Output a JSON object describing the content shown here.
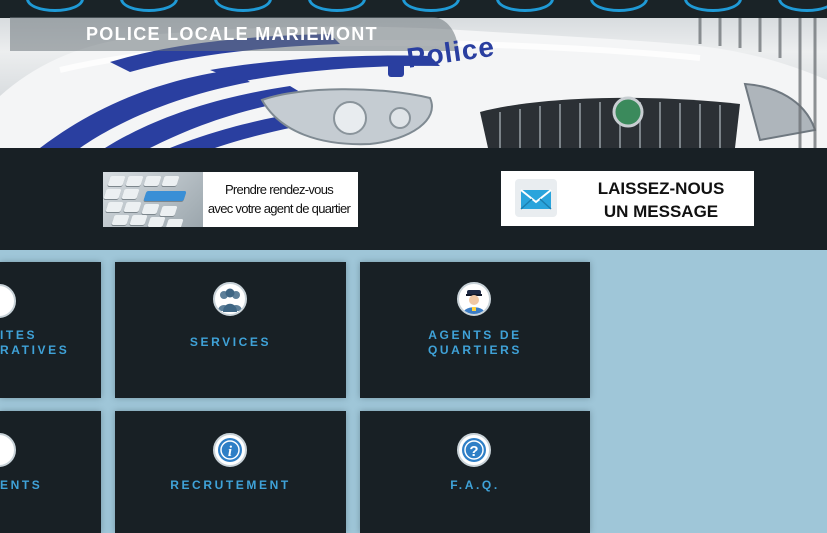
{
  "header": {
    "title": "POLICE LOCALE MARIEMONT",
    "car_lettering": "Police"
  },
  "banners": {
    "appointment": {
      "line1": "Prendre rendez-vous",
      "line2": "avec votre agent de quartier",
      "icon": "keyboard-icon"
    },
    "message": {
      "line1": "LAISSEZ-NOUS",
      "line2": "UN MESSAGE",
      "icon": "envelope-icon"
    }
  },
  "tiles": [
    {
      "line1": "ITES",
      "line2": "RATIVES",
      "icon": "partial-icon"
    },
    {
      "line1": "SERVICES",
      "icon": "group-icon"
    },
    {
      "line1": "AGENTS DE",
      "line2": "QUARTIERS",
      "icon": "police-officer-icon"
    },
    {
      "line1": "ENTS",
      "icon": "partial-icon"
    },
    {
      "line1": "RECRUTEMENT",
      "icon": "info-icon"
    },
    {
      "line1": "F.A.Q.",
      "icon": "question-icon"
    }
  ],
  "colors": {
    "page_background": "#9fc6d8",
    "dark_panel": "#182025",
    "tile_label": "#3fa2d8",
    "accent_blue": "#1f9ad6"
  }
}
